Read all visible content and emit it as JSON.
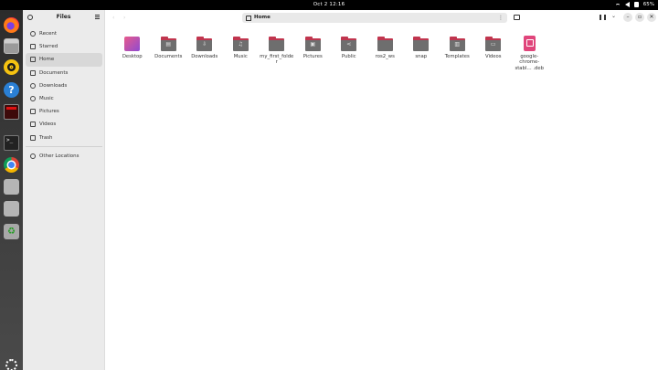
{
  "topbar": {
    "clock": "Oct 2  12:16",
    "battery": "65%"
  },
  "dock": {
    "terminal_prompt": ">_"
  },
  "window": {
    "sidebar": {
      "title": "Files",
      "items": [
        {
          "label": "Recent",
          "icon": "clock-icon"
        },
        {
          "label": "Starred",
          "icon": "star-icon"
        },
        {
          "label": "Home",
          "icon": "home-icon",
          "active": true
        },
        {
          "label": "Documents",
          "icon": "document-icon"
        },
        {
          "label": "Downloads",
          "icon": "download-icon"
        },
        {
          "label": "Music",
          "icon": "music-icon"
        },
        {
          "label": "Pictures",
          "icon": "picture-icon"
        },
        {
          "label": "Videos",
          "icon": "video-icon"
        },
        {
          "label": "Trash",
          "icon": "trash-icon"
        }
      ],
      "other_locations": "Other Locations"
    },
    "path": {
      "label": "Home",
      "menu": "⋮"
    },
    "files": [
      {
        "name": "Desktop",
        "type": "desktop"
      },
      {
        "name": "Documents",
        "type": "folder",
        "glyph": "▤"
      },
      {
        "name": "Downloads",
        "type": "folder",
        "glyph": "⇩"
      },
      {
        "name": "Music",
        "type": "folder",
        "glyph": "♫"
      },
      {
        "name": "my_first_folder",
        "type": "folder",
        "glyph": ""
      },
      {
        "name": "Pictures",
        "type": "folder",
        "glyph": "▣"
      },
      {
        "name": "Public",
        "type": "folder",
        "glyph": "⋖"
      },
      {
        "name": "ros2_ws",
        "type": "folder",
        "glyph": ""
      },
      {
        "name": "snap",
        "type": "folder",
        "glyph": ""
      },
      {
        "name": "Templates",
        "type": "folder",
        "glyph": "▥"
      },
      {
        "name": "Videos",
        "type": "folder",
        "glyph": "▭"
      },
      {
        "name": "google-chrome-stabl… .deb",
        "type": "deb"
      }
    ]
  }
}
